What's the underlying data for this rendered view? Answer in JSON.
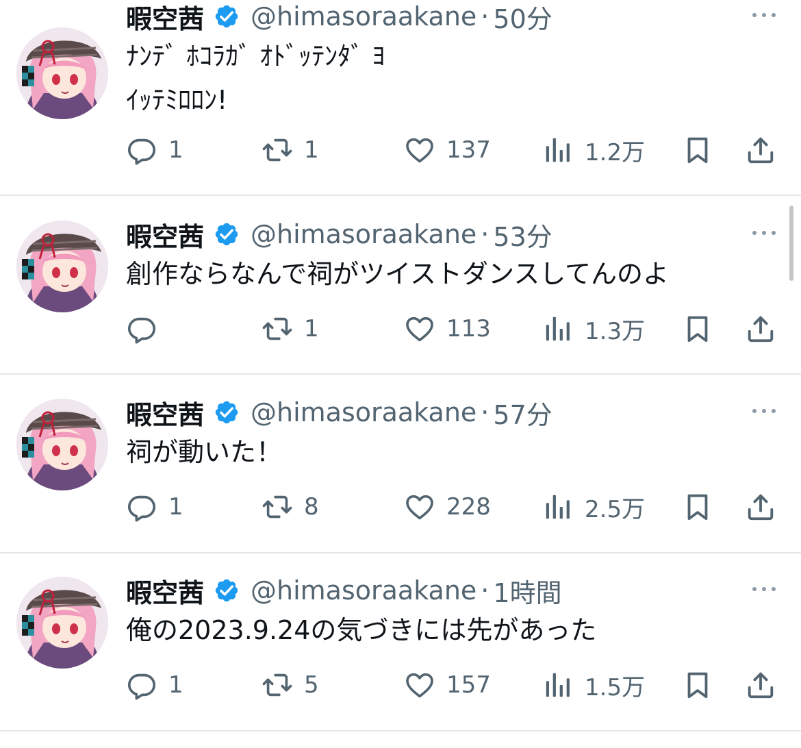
{
  "tweets": [
    {
      "name": "暇空茜",
      "handle": "@himasoraakane",
      "dot": "·",
      "time": "50分",
      "lines": [
        "ﾅﾝﾃﾞ ﾎｺﾗｶﾞ ｵﾄﾞｯﾃﾝﾀﾞ ﾖ",
        "ｲｯﾃﾐﾛﾛﾝ!"
      ],
      "replies": "1",
      "retweets": "1",
      "likes": "137",
      "views": "1.2万"
    },
    {
      "name": "暇空茜",
      "handle": "@himasoraakane",
      "dot": "·",
      "time": "53分",
      "lines": [
        "創作ならなんで祠がツイストダンスしてんのよ"
      ],
      "replies": "",
      "retweets": "1",
      "likes": "113",
      "views": "1.3万"
    },
    {
      "name": "暇空茜",
      "handle": "@himasoraakane",
      "dot": "·",
      "time": "57分",
      "lines": [
        "祠が動いた！"
      ],
      "replies": "1",
      "retweets": "8",
      "likes": "228",
      "views": "2.5万"
    },
    {
      "name": "暇空茜",
      "handle": "@himasoraakane",
      "dot": "·",
      "time": "1時間",
      "lines": [
        "俺の2023.9.24の気づきには先があった"
      ],
      "replies": "1",
      "retweets": "5",
      "likes": "157",
      "views": "1.5万"
    }
  ],
  "colors": {
    "verified": "#1d9bf0",
    "secondary": "#536471",
    "divider": "#e3e7ea"
  },
  "icons": [
    "avatar",
    "verified-badge-icon",
    "more-icon",
    "reply-icon",
    "retweet-icon",
    "like-icon",
    "views-icon",
    "bookmark-icon",
    "share-icon"
  ]
}
